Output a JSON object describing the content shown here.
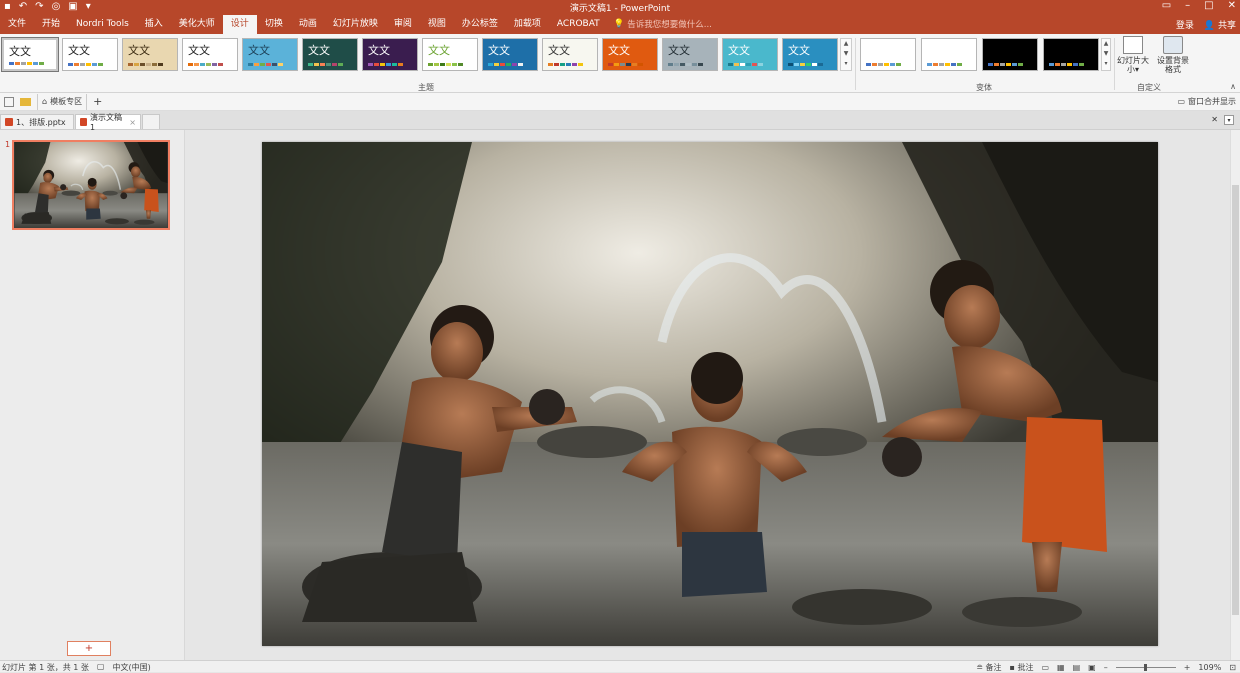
{
  "window": {
    "title": "演示文稿1 - PowerPoint"
  },
  "menu": {
    "tabs": [
      {
        "label": "文件"
      },
      {
        "label": "开始"
      },
      {
        "label": "Nordri Tools"
      },
      {
        "label": "插入"
      },
      {
        "label": "美化大师"
      },
      {
        "label": "设计"
      },
      {
        "label": "切换"
      },
      {
        "label": "动画"
      },
      {
        "label": "幻灯片放映"
      },
      {
        "label": "审阅"
      },
      {
        "label": "视图"
      },
      {
        "label": "办公标签"
      },
      {
        "label": "加载项"
      },
      {
        "label": "ACROBAT"
      }
    ],
    "active_tab": "设计",
    "tell_me": "告诉我您想要做什么...",
    "login": "登录",
    "share": "共享"
  },
  "ribbon": {
    "themes_label": "主题",
    "variants_label": "变体",
    "customize_label": "自定义",
    "slide_size": "幻灯片大小",
    "format_bg": "设置背景格式",
    "theme_text": "文文",
    "themes": [
      {
        "bg": "#ffffff",
        "fg": "#222222",
        "bars": [
          "#4472c4",
          "#ed7d31",
          "#a5a5a5",
          "#ffc000",
          "#5b9bd5",
          "#70ad47"
        ]
      },
      {
        "bg": "#ffffff",
        "fg": "#222222",
        "bars": [
          "#4472c4",
          "#ed7d31",
          "#a5a5a5",
          "#ffc000",
          "#5b9bd5",
          "#70ad47"
        ]
      },
      {
        "bg": "#e9d7b0",
        "fg": "#3a2a10",
        "bars": [
          "#a9662f",
          "#d9a441",
          "#6b4f2a",
          "#c8b08a",
          "#8c6d3a",
          "#4f3a1e"
        ]
      },
      {
        "bg": "#ffffff",
        "fg": "#222222",
        "bars": [
          "#e46c0a",
          "#f79646",
          "#4bacc6",
          "#9bbb59",
          "#8064a2",
          "#c0504d"
        ]
      },
      {
        "bg": "#5bb2d9",
        "fg": "#1b3e55",
        "bars": [
          "#2c7da0",
          "#f9a03f",
          "#70ad47",
          "#e15554",
          "#3a506b",
          "#ffd166"
        ]
      },
      {
        "bg": "#1f4d48",
        "fg": "#ffffff",
        "bars": [
          "#3fb68b",
          "#f2c14e",
          "#f78154",
          "#4d9078",
          "#b4436c",
          "#5fad56"
        ]
      },
      {
        "bg": "#3a1d4f",
        "fg": "#ffffff",
        "bars": [
          "#9b59b6",
          "#e74c3c",
          "#f1c40f",
          "#3498db",
          "#1abc9c",
          "#e67e22"
        ]
      },
      {
        "bg": "#ffffff",
        "fg": "#6aa22f",
        "bars": [
          "#6aa22f",
          "#a3c644",
          "#3d7a1a",
          "#d4e157",
          "#8bc34a",
          "#558b2f"
        ]
      },
      {
        "bg": "#1e6fa8",
        "fg": "#ffffff",
        "bars": [
          "#2aa7d9",
          "#f4d03f",
          "#e74c3c",
          "#27ae60",
          "#8e44ad",
          "#ecf0f1"
        ]
      },
      {
        "bg": "#f7f7f0",
        "fg": "#333333",
        "bars": [
          "#e67e22",
          "#c0392b",
          "#16a085",
          "#2980b9",
          "#8e44ad",
          "#f1c40f"
        ]
      },
      {
        "bg": "#e05a10",
        "fg": "#ffffff",
        "bars": [
          "#c0392b",
          "#f39c12",
          "#7f8c8d",
          "#2c3e50",
          "#e67e22",
          "#d35400"
        ]
      },
      {
        "bg": "#a7b3ba",
        "fg": "#1f2a30",
        "bars": [
          "#607d8b",
          "#90a4ae",
          "#455a64",
          "#b0bec5",
          "#78909c",
          "#37474f"
        ]
      },
      {
        "bg": "#4ab8cc",
        "fg": "#ffffff",
        "bars": [
          "#1a7a8c",
          "#f2c14e",
          "#ffffff",
          "#2b9eb3",
          "#e15554",
          "#8cd3df"
        ]
      },
      {
        "bg": "#2a8fc0",
        "fg": "#ffffff",
        "bars": [
          "#0d4f73",
          "#7fd1f2",
          "#f4d03f",
          "#2ecc71",
          "#ffffff",
          "#1b6a94"
        ]
      }
    ],
    "variants": [
      {
        "bg": "#ffffff",
        "bars": [
          "#4472c4",
          "#ed7d31",
          "#a5a5a5",
          "#ffc000",
          "#5b9bd5",
          "#70ad47"
        ]
      },
      {
        "bg": "#ffffff",
        "bars": [
          "#5b9bd5",
          "#ed7d31",
          "#a5a5a5",
          "#ffc000",
          "#4472c4",
          "#70ad47"
        ]
      },
      {
        "bg": "#000000",
        "bars": [
          "#4472c4",
          "#ed7d31",
          "#a5a5a5",
          "#ffc000",
          "#5b9bd5",
          "#70ad47"
        ]
      },
      {
        "bg": "#000000",
        "bars": [
          "#5b9bd5",
          "#ed7d31",
          "#a5a5a5",
          "#ffc000",
          "#4472c4",
          "#70ad47"
        ]
      }
    ]
  },
  "quickbar": {
    "template_zone": "模板专区",
    "window_merge": "窗口合并显示"
  },
  "doc_tabs": [
    {
      "label": "1、排版.pptx",
      "active": false
    },
    {
      "label": "演示文稿1",
      "active": true
    }
  ],
  "thumbnails": {
    "slide_number": "1",
    "add_label": "+"
  },
  "status": {
    "slide_info": "幻灯片 第 1 张，共 1 张",
    "language": "中文(中国)",
    "notes": "备注",
    "comments": "批注",
    "zoom": "109%"
  },
  "colors": {
    "accent": "#b7472a",
    "selection": "#f07e61"
  }
}
